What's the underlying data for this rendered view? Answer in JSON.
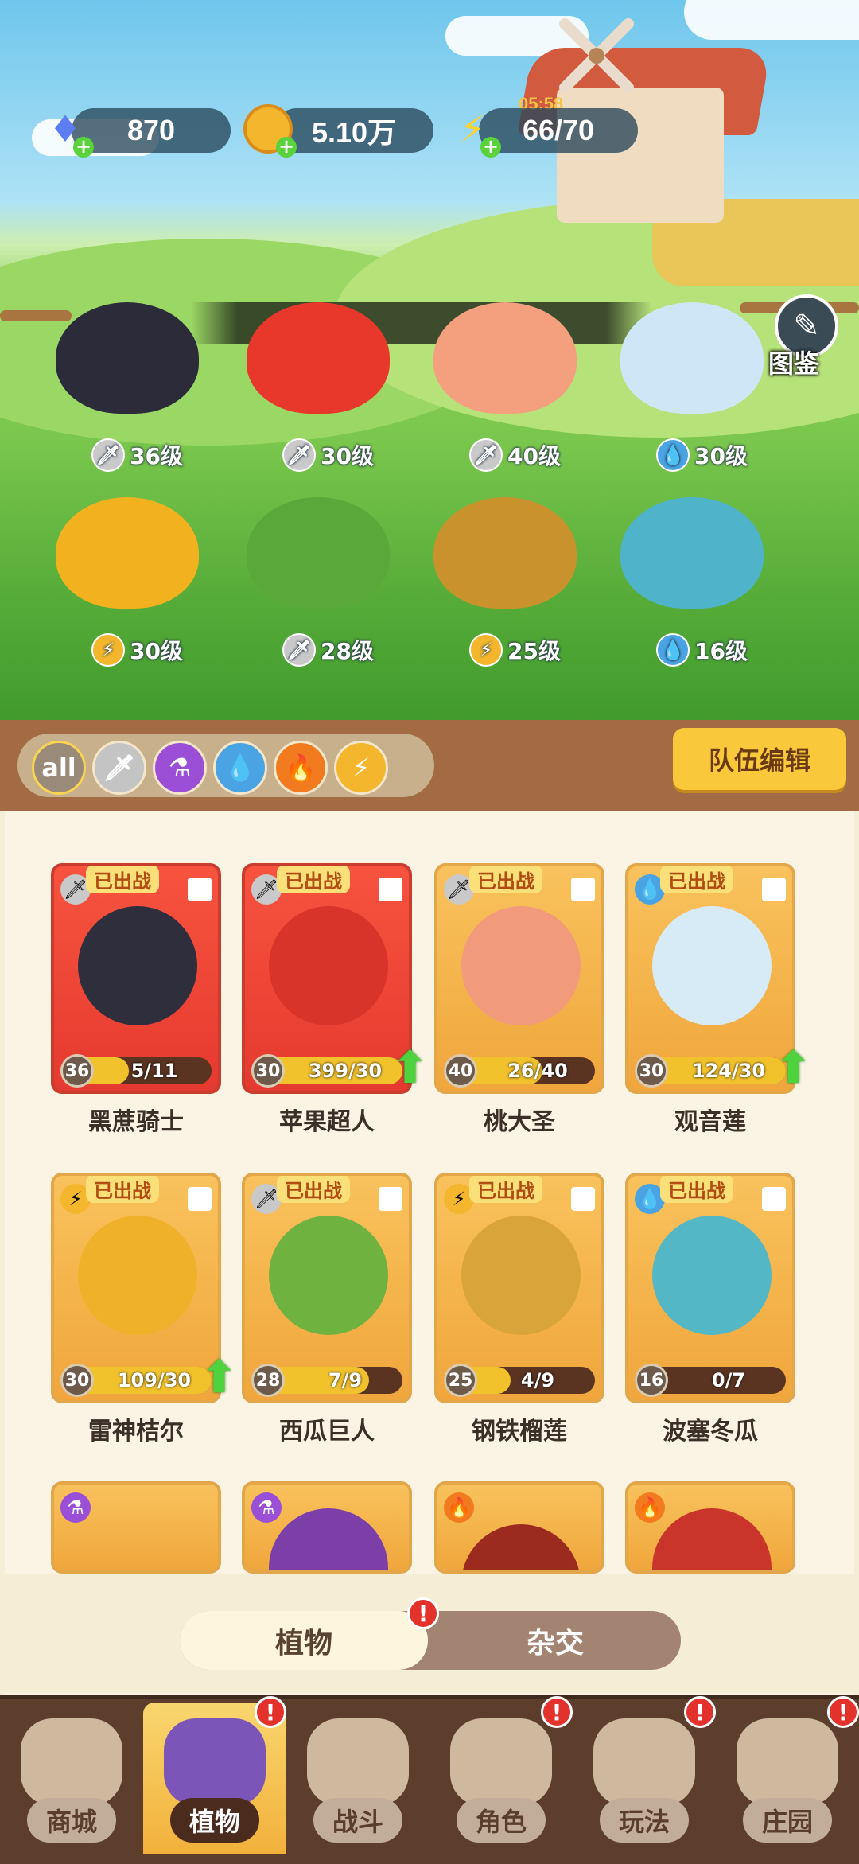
{
  "resources": {
    "gems": "870",
    "coins": "5.10万",
    "energy": "66/70",
    "energy_timer": "05:58"
  },
  "dex_label": "图鉴",
  "formation": [
    {
      "level": "36级",
      "element": "sword"
    },
    {
      "level": "30级",
      "element": "sword"
    },
    {
      "level": "40级",
      "element": "sword"
    },
    {
      "level": "30级",
      "element": "water"
    },
    {
      "level": "30级",
      "element": "lightning"
    },
    {
      "level": "28级",
      "element": "sword"
    },
    {
      "level": "25级",
      "element": "lightning"
    },
    {
      "level": "16级",
      "element": "water"
    }
  ],
  "filters": [
    {
      "label": "all",
      "icon": "all"
    },
    {
      "icon": "sword-icon"
    },
    {
      "icon": "potion-icon"
    },
    {
      "icon": "water-drop-icon"
    },
    {
      "icon": "fire-icon"
    },
    {
      "icon": "lightning-icon"
    }
  ],
  "team_edit_label": "队伍编辑",
  "deployed_label": "已出战",
  "cards": [
    {
      "name": "黑蔗骑士",
      "level": "36",
      "fragments": "5/11",
      "progress": 0.45,
      "element": "sword",
      "upgrade": false
    },
    {
      "name": "苹果超人",
      "level": "30",
      "fragments": "399/30",
      "progress": 1.0,
      "element": "sword",
      "upgrade": true
    },
    {
      "name": "桃大圣",
      "level": "40",
      "fragments": "26/40",
      "progress": 0.65,
      "element": "sword",
      "upgrade": false
    },
    {
      "name": "观音莲",
      "level": "30",
      "fragments": "124/30",
      "progress": 1.0,
      "element": "water",
      "upgrade": true
    },
    {
      "name": "雷神桔尔",
      "level": "30",
      "fragments": "109/30",
      "progress": 1.0,
      "element": "lightning",
      "upgrade": true
    },
    {
      "name": "西瓜巨人",
      "level": "28",
      "fragments": "7/9",
      "progress": 0.78,
      "element": "sword",
      "upgrade": false
    },
    {
      "name": "钢铁榴莲",
      "level": "25",
      "fragments": "4/9",
      "progress": 0.44,
      "element": "lightning",
      "upgrade": false
    },
    {
      "name": "波塞冬瓜",
      "level": "16",
      "fragments": "0/7",
      "progress": 0.0,
      "element": "water",
      "upgrade": false
    }
  ],
  "toggle": {
    "left": "植物",
    "right": "杂交",
    "alert": "!"
  },
  "nav": [
    {
      "label": "商城",
      "alert": false
    },
    {
      "label": "植物",
      "alert": true,
      "active": true
    },
    {
      "label": "战斗",
      "alert": false
    },
    {
      "label": "角色",
      "alert": true
    },
    {
      "label": "玩法",
      "alert": true
    },
    {
      "label": "庄园",
      "alert": true
    }
  ],
  "alert_glyph": "!",
  "colors": {
    "accent": "#f9c93b",
    "deployed_card": "#e53a2f",
    "normal_card": "#f0a63c",
    "upgrade_arrow": "#4ed23d"
  }
}
